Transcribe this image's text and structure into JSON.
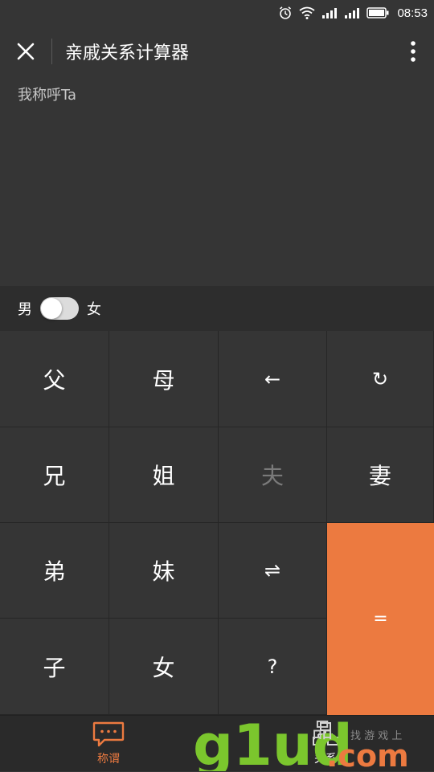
{
  "status_bar": {
    "time": "08:53"
  },
  "header": {
    "title": "亲戚关系计算器"
  },
  "display": {
    "label": "我称呼Ta"
  },
  "gender": {
    "male_label": "男",
    "female_label": "女"
  },
  "keypad": {
    "father": "父",
    "mother": "母",
    "backspace": "←",
    "reset": "↻",
    "elder_brother": "兄",
    "elder_sister": "姐",
    "husband": "夫",
    "wife": "妻",
    "younger_brother": "弟",
    "younger_sister": "妹",
    "swap": "⇌",
    "equals": "=",
    "son": "子",
    "daughter": "女",
    "question": "?"
  },
  "tabs": {
    "appellation": "称谓",
    "relation": "关系"
  },
  "watermark": {
    "text": "g1ud",
    "com": ".com",
    "pin": "品",
    "slogan": "找 游 戏 上"
  },
  "colors": {
    "accent": "#ec7a40",
    "background": "#353535",
    "watermark_green": "#7bc62d"
  }
}
